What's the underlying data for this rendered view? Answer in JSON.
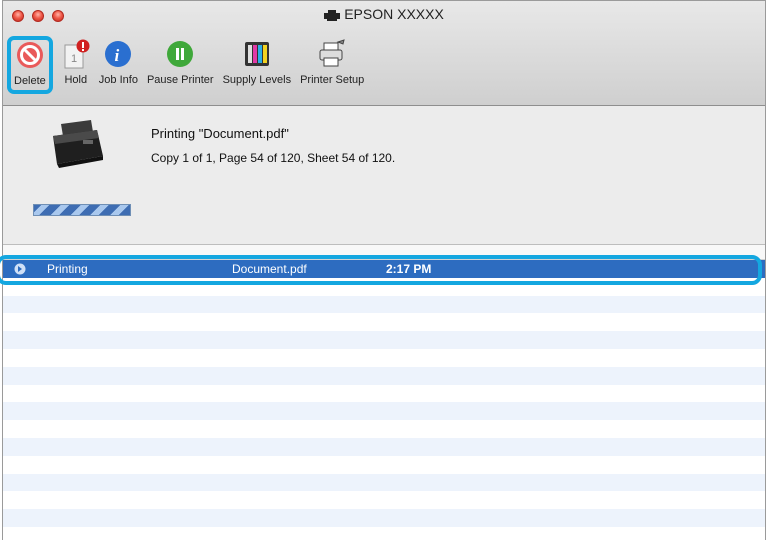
{
  "window": {
    "title": "EPSON XXXXX"
  },
  "toolbar": {
    "items": [
      {
        "label": "Delete",
        "icon": "delete-icon"
      },
      {
        "label": "Hold",
        "icon": "hold-icon"
      },
      {
        "label": "Job Info",
        "icon": "info-icon"
      },
      {
        "label": "Pause Printer",
        "icon": "pause-icon"
      },
      {
        "label": "Supply Levels",
        "icon": "ink-levels-icon"
      },
      {
        "label": "Printer Setup",
        "icon": "printer-setup-icon"
      }
    ],
    "highlight_color": "#14a7e0"
  },
  "status": {
    "title": "Printing \"Document.pdf\"",
    "detail": "Copy 1 of 1, Page 54 of 120, Sheet 54 of 120.",
    "progress_state": "indeterminate"
  },
  "jobs": [
    {
      "status": "Printing",
      "name": "Document.pdf",
      "time": "2:17 PM"
    }
  ],
  "colors": {
    "selection": "#2d6cc0",
    "accent": "#14a7e0"
  }
}
